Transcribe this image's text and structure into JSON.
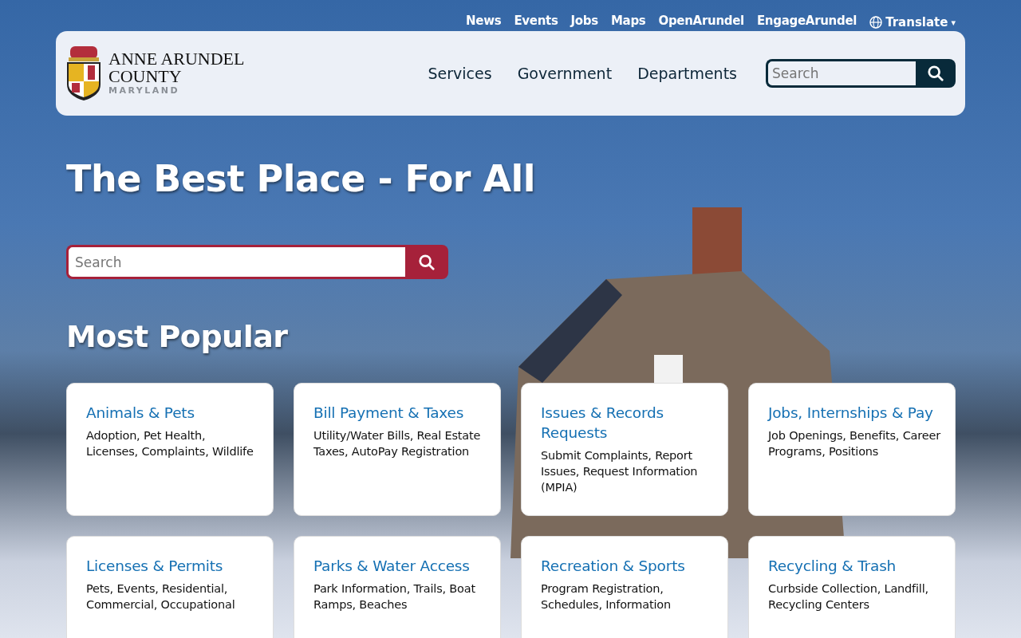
{
  "utility_nav": [
    "News",
    "Events",
    "Jobs",
    "Maps",
    "OpenArundel",
    "EngageArundel"
  ],
  "translate": {
    "label": "Translate",
    "caret": "▾"
  },
  "logo": {
    "line_1": "ANNE ARUNDEL",
    "line_2": "COUNTY",
    "line_3": "MARYLAND"
  },
  "main_nav": [
    "Services",
    "Government",
    "Departments"
  ],
  "header_search": {
    "placeholder": "Search"
  },
  "hero": {
    "title": "The Best Place - For All",
    "search_placeholder": "Search"
  },
  "popular": {
    "heading": "Most Popular",
    "cards": [
      {
        "title": "Animals & Pets",
        "description": "Adoption, Pet Health, Licenses, Complaints, Wildlife"
      },
      {
        "title": "Bill Payment & Taxes",
        "description": "Utility/Water Bills, Real Estate Taxes, AutoPay Registration"
      },
      {
        "title": "Issues & Records Requests",
        "description": "Submit Complaints, Report Issues, Request Information (MPIA)"
      },
      {
        "title": "Jobs, Internships & Pay",
        "description": "Job Openings, Benefits, Career Programs, Positions"
      },
      {
        "title": "Licenses & Permits",
        "description": "Pets, Events, Residential, Commercial, Occupational"
      },
      {
        "title": "Parks & Water Access",
        "description": "Park Information, Trails, Boat Ramps, Beaches"
      },
      {
        "title": "Recreation & Sports",
        "description": "Program Registration, Schedules, Information"
      },
      {
        "title": "Recycling & Trash",
        "description": "Curbside Collection, Landfill, Recycling Centers"
      }
    ]
  }
}
